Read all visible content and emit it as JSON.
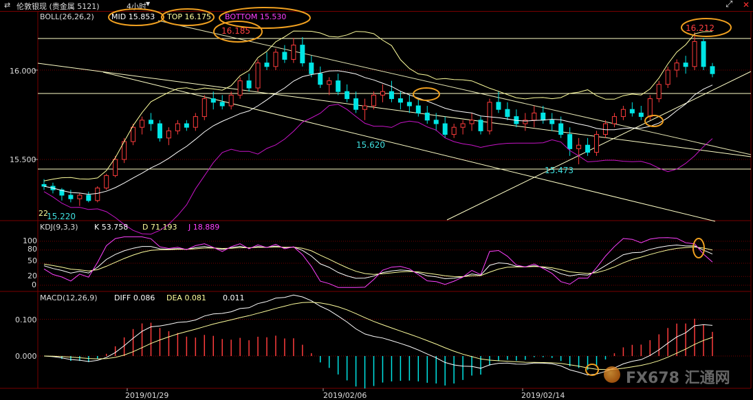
{
  "topbar": {
    "nav_icon": "swap-arrows-icon",
    "title": "伦敦银现 (贵金属  5121)",
    "period": "4小时",
    "arrow": "▼"
  },
  "panels": {
    "boll": {
      "label": "BOLL(26,26,2)",
      "mid": "MID 15.853",
      "top": "TOP 16.175",
      "bottom": "BOTTOM 15.530"
    },
    "kdj": {
      "label": "KDJ(9,3,3)",
      "k": "K 53.758",
      "d": "D 71.193",
      "j": "J 18.889"
    },
    "macd": {
      "label": "MACD(12,26,9)",
      "diff": "DIFF 0.086",
      "dea": "DEA 0.081",
      "val": "0.011"
    }
  },
  "annotations": {
    "high1": "16.185",
    "high2": "16.212",
    "low1": "15.620",
    "low2": "15.473",
    "low0": "15.220",
    "small": "22"
  },
  "axis": {
    "price_ticks": [
      "16.000",
      "15.500"
    ],
    "kdj_ticks": [
      "100",
      "80",
      "50",
      "20",
      "0"
    ],
    "macd_ticks": [
      "0.100",
      "0.000"
    ],
    "dates": [
      "2019/01/29",
      "2019/02/06",
      "2019/02/14"
    ]
  },
  "watermark": "FX678 汇通网",
  "colors": {
    "up": "#ff3c3c",
    "down": "#00e5e5",
    "ref": "#ffffc8",
    "boll_bottom": "#c814c8",
    "highlight": "#f0a020",
    "grid": "#7a0000"
  },
  "chart_data": {
    "type": "candlestick",
    "ylim": [
      15.2,
      16.3
    ],
    "ohlc": [
      [
        15.36,
        15.39,
        15.33,
        15.35
      ],
      [
        15.35,
        15.37,
        15.31,
        15.33
      ],
      [
        15.33,
        15.34,
        15.27,
        15.3
      ],
      [
        15.3,
        15.33,
        15.26,
        15.28
      ],
      [
        15.28,
        15.31,
        15.24,
        15.3
      ],
      [
        15.3,
        15.32,
        15.26,
        15.27
      ],
      [
        15.27,
        15.35,
        15.26,
        15.34
      ],
      [
        15.34,
        15.42,
        15.33,
        15.41
      ],
      [
        15.41,
        15.52,
        15.4,
        15.5
      ],
      [
        15.5,
        15.62,
        15.48,
        15.6
      ],
      [
        15.6,
        15.7,
        15.58,
        15.68
      ],
      [
        15.68,
        15.74,
        15.64,
        15.72
      ],
      [
        15.72,
        15.76,
        15.66,
        15.7
      ],
      [
        15.7,
        15.72,
        15.6,
        15.62
      ],
      [
        15.62,
        15.68,
        15.58,
        15.66
      ],
      [
        15.66,
        15.72,
        15.64,
        15.7
      ],
      [
        15.7,
        15.72,
        15.66,
        15.68
      ],
      [
        15.68,
        15.76,
        15.66,
        15.74
      ],
      [
        15.74,
        15.86,
        15.72,
        15.84
      ],
      [
        15.84,
        15.88,
        15.78,
        15.82
      ],
      [
        15.82,
        15.86,
        15.78,
        15.8
      ],
      [
        15.8,
        15.88,
        15.78,
        15.86
      ],
      [
        15.86,
        15.96,
        15.84,
        15.94
      ],
      [
        15.94,
        15.98,
        15.88,
        15.9
      ],
      [
        15.9,
        16.06,
        15.88,
        16.04
      ],
      [
        16.04,
        16.1,
        16.0,
        16.02
      ],
      [
        16.02,
        16.12,
        16.0,
        16.1
      ],
      [
        16.1,
        16.14,
        16.04,
        16.06
      ],
      [
        16.06,
        16.18,
        16.04,
        16.14
      ],
      [
        16.14,
        16.185,
        16.02,
        16.04
      ],
      [
        16.04,
        16.08,
        15.96,
        15.98
      ],
      [
        15.98,
        16.02,
        15.9,
        15.92
      ],
      [
        15.92,
        15.96,
        15.86,
        15.94
      ],
      [
        15.94,
        15.98,
        15.86,
        15.88
      ],
      [
        15.88,
        15.92,
        15.82,
        15.84
      ],
      [
        15.84,
        15.88,
        15.76,
        15.78
      ],
      [
        15.78,
        15.84,
        15.72,
        15.8
      ],
      [
        15.8,
        15.88,
        15.78,
        15.86
      ],
      [
        15.86,
        15.92,
        15.82,
        15.88
      ],
      [
        15.88,
        15.94,
        15.82,
        15.84
      ],
      [
        15.84,
        15.88,
        15.78,
        15.82
      ],
      [
        15.82,
        15.86,
        15.76,
        15.8
      ],
      [
        15.8,
        15.84,
        15.74,
        15.76
      ],
      [
        15.76,
        15.8,
        15.7,
        15.72
      ],
      [
        15.72,
        15.76,
        15.66,
        15.7
      ],
      [
        15.7,
        15.74,
        15.62,
        15.64
      ],
      [
        15.64,
        15.7,
        15.62,
        15.68
      ],
      [
        15.68,
        15.72,
        15.64,
        15.7
      ],
      [
        15.7,
        15.76,
        15.66,
        15.72
      ],
      [
        15.72,
        15.74,
        15.64,
        15.66
      ],
      [
        15.66,
        15.84,
        15.64,
        15.82
      ],
      [
        15.82,
        15.88,
        15.76,
        15.78
      ],
      [
        15.78,
        15.82,
        15.72,
        15.74
      ],
      [
        15.74,
        15.78,
        15.68,
        15.7
      ],
      [
        15.7,
        15.76,
        15.66,
        15.72
      ],
      [
        15.72,
        15.8,
        15.68,
        15.76
      ],
      [
        15.76,
        15.8,
        15.7,
        15.72
      ],
      [
        15.72,
        15.76,
        15.66,
        15.7
      ],
      [
        15.7,
        15.74,
        15.62,
        15.64
      ],
      [
        15.64,
        15.68,
        15.52,
        15.56
      ],
      [
        15.56,
        15.62,
        15.473,
        15.58
      ],
      [
        15.58,
        15.62,
        15.52,
        15.54
      ],
      [
        15.54,
        15.66,
        15.52,
        15.64
      ],
      [
        15.64,
        15.72,
        15.62,
        15.7
      ],
      [
        15.7,
        15.76,
        15.68,
        15.74
      ],
      [
        15.74,
        15.8,
        15.72,
        15.78
      ],
      [
        15.78,
        15.82,
        15.74,
        15.76
      ],
      [
        15.76,
        15.8,
        15.72,
        15.74
      ],
      [
        15.74,
        15.86,
        15.72,
        15.84
      ],
      [
        15.84,
        15.94,
        15.82,
        15.92
      ],
      [
        15.92,
        16.02,
        15.9,
        16.0
      ],
      [
        16.0,
        16.06,
        15.96,
        16.04
      ],
      [
        16.04,
        16.08,
        15.98,
        16.02
      ],
      [
        16.02,
        16.212,
        16.0,
        16.16
      ],
      [
        16.16,
        16.18,
        16.0,
        16.02
      ],
      [
        16.02,
        16.04,
        15.96,
        15.98
      ]
    ]
  }
}
